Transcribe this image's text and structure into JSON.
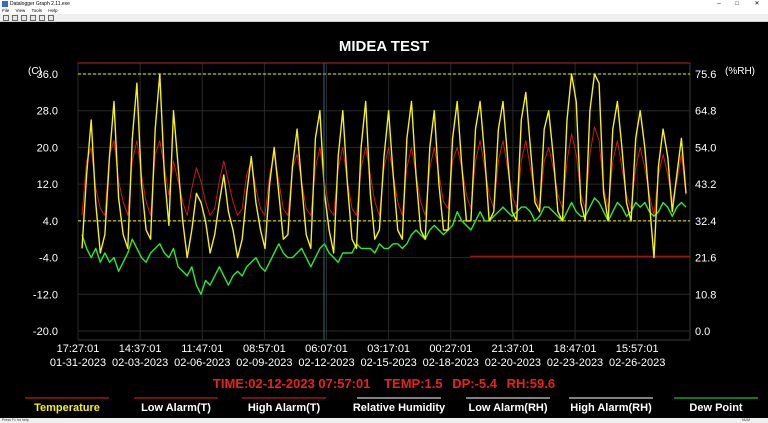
{
  "window": {
    "title": "Datalogger Graph 2.11.exe",
    "controls": {
      "minimize": "–",
      "maximize": "□",
      "close": "✕"
    }
  },
  "menu": [
    "File",
    "View",
    "Tools",
    "Help"
  ],
  "toolbar_icons": [
    "open-icon",
    "save-icon",
    "copy-icon",
    "print-icon",
    "export-icon",
    "zoom-icon"
  ],
  "status": {
    "left": "Press F1 for help",
    "right": "NUM"
  },
  "colors": {
    "background": "#000000",
    "temperature": "#f5f016",
    "temp_alarm": "#cc1b12",
    "humidity": "#f5f016",
    "dew_point": "#2ee82e",
    "readout": "#e8231a",
    "cursor": "#2e6b7a"
  },
  "readout": {
    "time": "TIME:02-12-2023 07:57:01",
    "temp": "TEMP:1.5",
    "dp": "DP:-5.4",
    "rh": "RH:59.6"
  },
  "legend": [
    {
      "label": "Temperature",
      "color": "#f5f016",
      "underline": "#e8231a"
    },
    {
      "label": "Low Alarm(T)",
      "color": "#ffffff",
      "underline": "#e8231a"
    },
    {
      "label": "High Alarm(T)",
      "color": "#ffffff",
      "underline": "#e8231a"
    },
    {
      "label": "Relative Humidity",
      "color": "#ffffff",
      "underline": "#ffffff"
    },
    {
      "label": "Low Alarm(RH)",
      "color": "#ffffff",
      "underline": "#ffffff"
    },
    {
      "label": "High Alarm(RH)",
      "color": "#ffffff",
      "underline": "#ffffff"
    },
    {
      "label": "Dew Point",
      "color": "#ffffff",
      "underline": "#2ee82e"
    }
  ],
  "chart_data": {
    "type": "line",
    "title": "MIDEA TEST",
    "ylabel_left": "(C)",
    "ylabel_right": "(%RH)",
    "y_left_ticks": [
      "36.0",
      "28.0",
      "20.0",
      "12.0",
      "4.0",
      "-4.0",
      "-12.0",
      "-20.0"
    ],
    "y_left_values": [
      36,
      28,
      20,
      12,
      4,
      -4,
      -12,
      -20
    ],
    "ylim_left": [
      -20,
      36
    ],
    "y_right_ticks": [
      "75.6",
      "64.8",
      "54.0",
      "43.2",
      "32.4",
      "21.6",
      "10.8",
      "0.0"
    ],
    "y_right_values": [
      75.6,
      64.8,
      54.0,
      43.2,
      32.4,
      21.6,
      10.8,
      0.0
    ],
    "ylim_right": [
      0,
      75.6
    ],
    "x_ticks": [
      {
        "time": "17:27:01",
        "date": "01-31-2023"
      },
      {
        "time": "14:37:01",
        "date": "02-03-2023"
      },
      {
        "time": "11:47:01",
        "date": "02-06-2023"
      },
      {
        "time": "08:57:01",
        "date": "02-09-2023"
      },
      {
        "time": "06:07:01",
        "date": "02-12-2023"
      },
      {
        "time": "03:17:01",
        "date": "02-15-2023"
      },
      {
        "time": "00:27:01",
        "date": "02-18-2023"
      },
      {
        "time": "21:37:01",
        "date": "02-20-2023"
      },
      {
        "time": "18:47:01",
        "date": "02-23-2023"
      },
      {
        "time": "15:57:01",
        "date": "02-26-2023"
      }
    ],
    "alarm_lines": {
      "temp_high": 36.0,
      "temp_low": 4.0,
      "rh_high": 75.6,
      "rh_low": 22.0
    },
    "cursor_date": "02-12-2023 07:57:01",
    "grid": true,
    "legend_position": "bottom",
    "series": [
      {
        "name": "Temperature",
        "color": "#f5f016",
        "axis": "left",
        "values": [
          -2,
          14,
          26,
          8,
          -3,
          1,
          18,
          30,
          9,
          1,
          -2,
          22,
          34,
          12,
          2,
          0,
          24,
          36,
          14,
          3,
          28,
          16,
          4,
          -4,
          2,
          10,
          8,
          4,
          -3,
          1,
          8,
          14,
          6,
          2,
          -4,
          0,
          10,
          18,
          8,
          2,
          -2,
          12,
          20,
          10,
          0,
          1,
          16,
          24,
          12,
          1,
          -2,
          22,
          28,
          10,
          2,
          -3,
          18,
          28,
          12,
          0,
          -2,
          20,
          30,
          10,
          0,
          2,
          18,
          28,
          14,
          2,
          0,
          22,
          30,
          14,
          2,
          0,
          20,
          28,
          12,
          2,
          2,
          22,
          30,
          16,
          4,
          4,
          24,
          30,
          18,
          4,
          6,
          24,
          30,
          18,
          6,
          4,
          26,
          32,
          20,
          8,
          6,
          24,
          28,
          18,
          6,
          4,
          26,
          36,
          30,
          8,
          4,
          28,
          36,
          34,
          10,
          4,
          24,
          30,
          20,
          8,
          4,
          22,
          28,
          20,
          8,
          -4,
          16,
          24,
          18,
          6,
          14,
          22,
          10
        ]
      },
      {
        "name": "Relative Humidity",
        "color": "#cc1b12",
        "axis": "right",
        "values": [
          34,
          50,
          54,
          42,
          36,
          34,
          52,
          56,
          44,
          38,
          34,
          50,
          56,
          46,
          38,
          34,
          52,
          56,
          48,
          40,
          50,
          44,
          38,
          34,
          42,
          48,
          44,
          38,
          34,
          36,
          44,
          50,
          44,
          38,
          34,
          36,
          46,
          50,
          42,
          36,
          34,
          46,
          52,
          44,
          36,
          34,
          48,
          52,
          44,
          36,
          34,
          48,
          54,
          44,
          36,
          34,
          48,
          54,
          44,
          36,
          34,
          48,
          54,
          46,
          38,
          34,
          48,
          54,
          46,
          38,
          34,
          48,
          54,
          46,
          38,
          34,
          48,
          54,
          46,
          38,
          36,
          50,
          54,
          48,
          40,
          36,
          50,
          56,
          48,
          40,
          36,
          50,
          56,
          48,
          40,
          36,
          50,
          56,
          48,
          40,
          36,
          50,
          54,
          48,
          40,
          36,
          50,
          58,
          52,
          40,
          36,
          52,
          60,
          56,
          42,
          36,
          50,
          56,
          48,
          40,
          36,
          48,
          54,
          48,
          40,
          34,
          46,
          52,
          46,
          38,
          44,
          52,
          40
        ]
      },
      {
        "name": "Dew Point",
        "color": "#2ee82e",
        "axis": "left",
        "values": [
          1,
          -2,
          -4,
          -2,
          -5,
          -3,
          -5,
          -4,
          -7,
          -5,
          -3,
          0,
          -2,
          -4,
          -5,
          -3,
          -2,
          -1,
          -3,
          -4,
          -2,
          -6,
          -7,
          -8,
          -6,
          -10,
          -12,
          -9,
          -10,
          -8,
          -6,
          -8,
          -10,
          -8,
          -7,
          -8,
          -6,
          -5,
          -4,
          -6,
          -7,
          -5,
          -3,
          -1,
          -3,
          -4,
          -4,
          -3,
          -2,
          -4,
          -6,
          -4,
          -2,
          -1,
          -3,
          -4,
          -5,
          -3,
          -3,
          -3,
          -1,
          -2,
          -2,
          -2,
          -3,
          -1,
          -2,
          -2,
          -1,
          -1,
          -2,
          -1,
          1,
          2,
          1,
          0,
          2,
          3,
          2,
          1,
          2,
          3,
          6,
          4,
          3,
          2,
          4,
          6,
          4,
          4,
          5,
          6,
          7,
          6,
          5,
          6,
          7,
          7,
          6,
          4,
          5,
          7,
          7,
          6,
          5,
          4,
          6,
          8,
          6,
          5,
          5,
          7,
          9,
          8,
          6,
          4,
          6,
          8,
          7,
          5,
          6,
          8,
          7,
          8,
          6,
          5,
          6,
          8,
          7,
          5,
          7,
          8,
          7
        ]
      }
    ]
  }
}
